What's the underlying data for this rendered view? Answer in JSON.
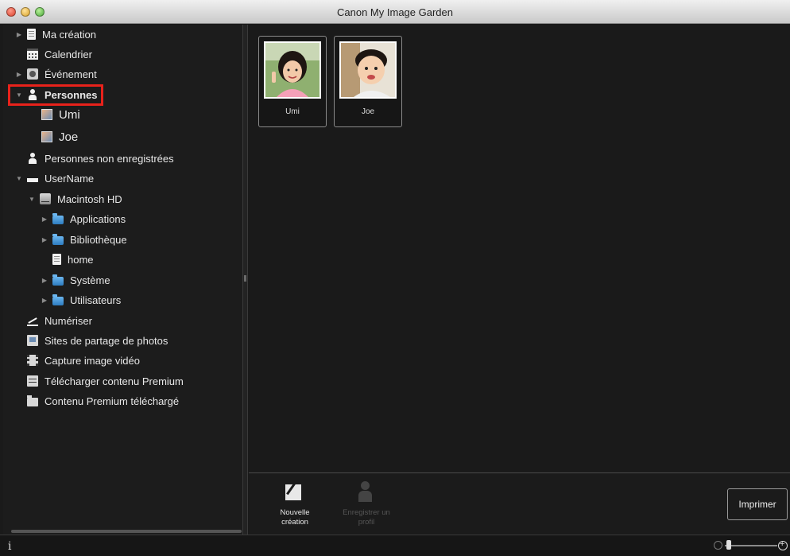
{
  "window": {
    "title": "Canon My Image Garden"
  },
  "sidebar": {
    "items": [
      {
        "label": "Ma création",
        "icon": "my-creation-icon"
      },
      {
        "label": "Calendrier",
        "icon": "calendar-icon"
      },
      {
        "label": "Événement",
        "icon": "event-icon"
      },
      {
        "label": "Personnes",
        "icon": "person-icon"
      },
      {
        "label": "Umi",
        "icon": "profile-photo-icon"
      },
      {
        "label": "Joe",
        "icon": "profile-photo-icon"
      },
      {
        "label": "Personnes non enregistrées",
        "icon": "unregistered-person-icon"
      },
      {
        "label": "UserName",
        "icon": "user-icon"
      },
      {
        "label": "Macintosh HD",
        "icon": "hard-disk-icon"
      },
      {
        "label": "Applications",
        "icon": "folder-icon"
      },
      {
        "label": "Bibliothèque",
        "icon": "folder-icon"
      },
      {
        "label": "home",
        "icon": "document-icon"
      },
      {
        "label": "Système",
        "icon": "folder-icon"
      },
      {
        "label": "Utilisateurs",
        "icon": "folder-icon"
      },
      {
        "label": "Numériser",
        "icon": "scan-icon"
      },
      {
        "label": "Sites de partage de photos",
        "icon": "photo-sharing-icon"
      },
      {
        "label": "Capture image vidéo",
        "icon": "video-capture-icon"
      },
      {
        "label": "Télécharger contenu Premium",
        "icon": "download-premium-icon"
      },
      {
        "label": "Contenu Premium téléchargé",
        "icon": "premium-folder-icon"
      }
    ],
    "selected": "Personnes"
  },
  "main": {
    "people": [
      {
        "name": "Umi"
      },
      {
        "name": "Joe"
      }
    ]
  },
  "toolbar": {
    "new_creation": "Nouvelle création",
    "register_profile": "Enregistrer un profil",
    "print": "Imprimer"
  },
  "status": {
    "info": "i"
  },
  "colors": {
    "highlight": "#e8221b",
    "background": "#1a1a1a",
    "folder": "#2d7cc0"
  }
}
